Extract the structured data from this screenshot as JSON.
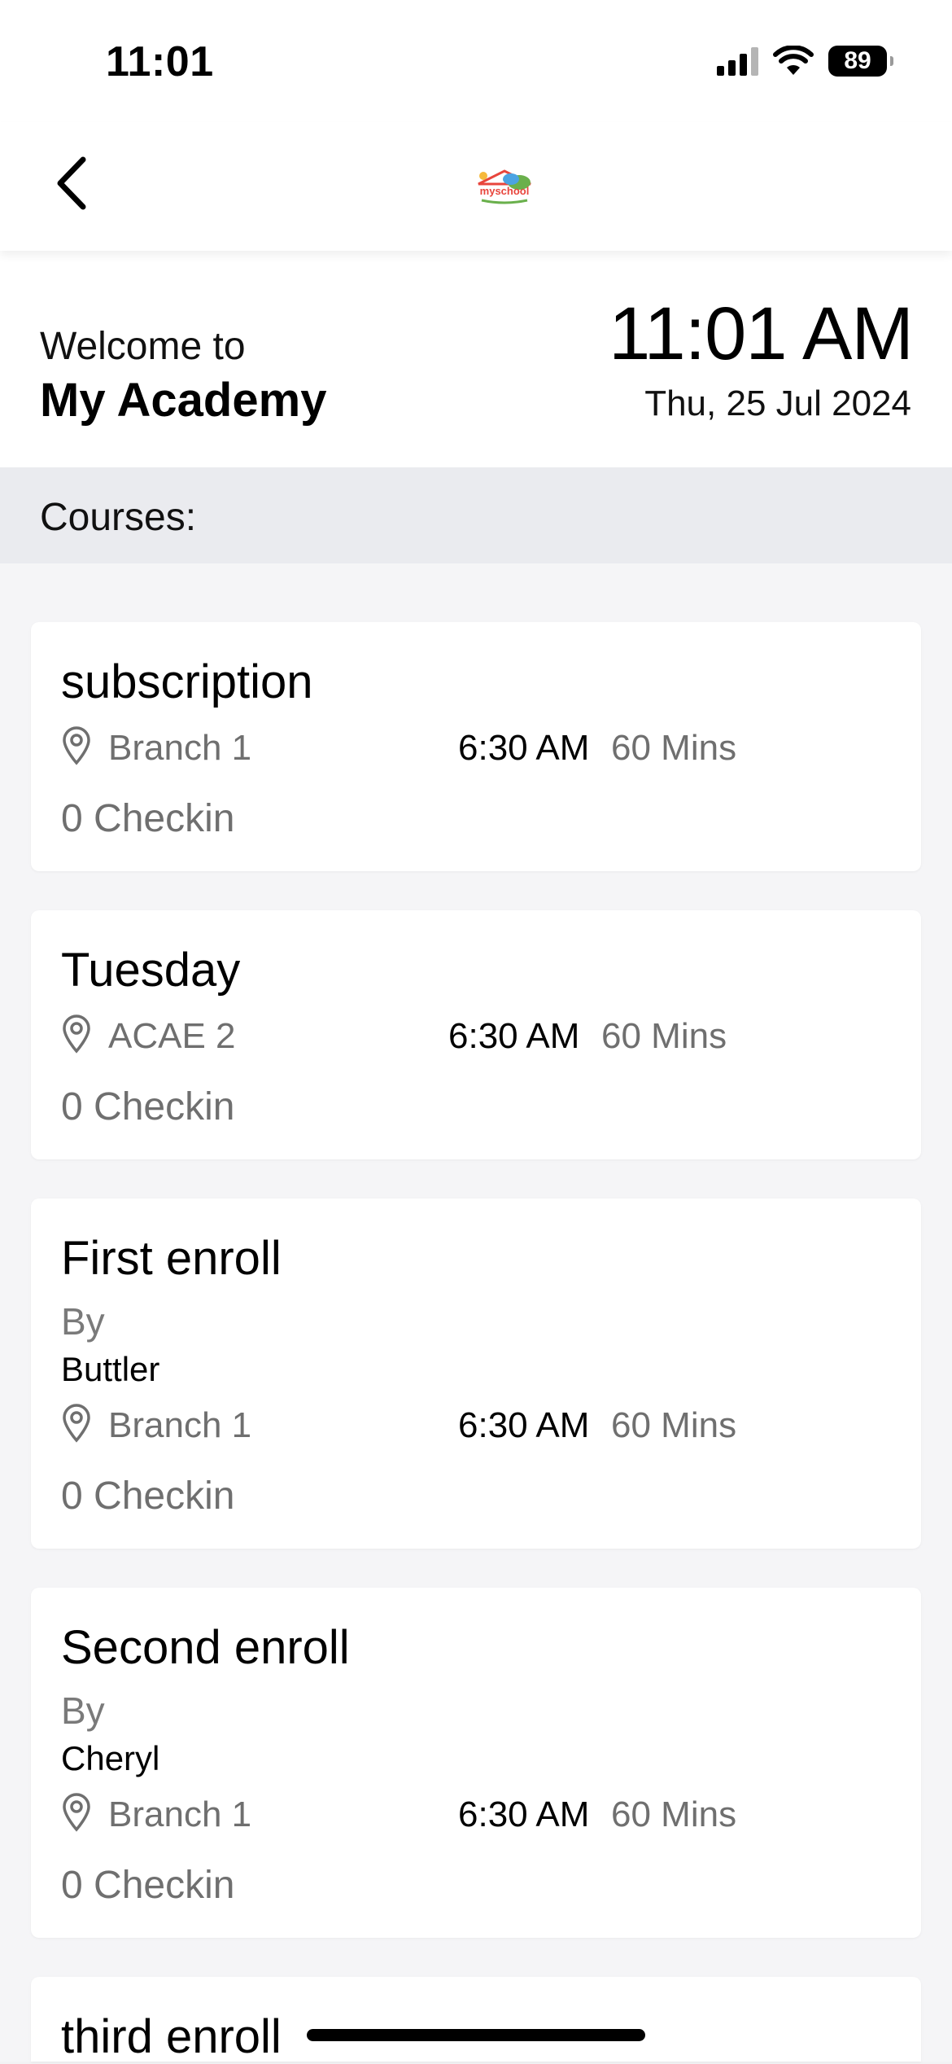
{
  "status_bar": {
    "time": "11:01",
    "battery": "89"
  },
  "nav": {
    "logo_text": "mySCHOOL"
  },
  "header": {
    "welcome": "Welcome to",
    "academy": "My Academy",
    "time": "11:01 AM",
    "date": "Thu, 25 Jul 2024"
  },
  "section": {
    "title": "Courses:"
  },
  "courses": [
    {
      "title": "subscription",
      "location": "Branch 1",
      "time": "6:30 AM",
      "duration": "60 Mins",
      "checkin": "0 Checkin"
    },
    {
      "title": "Tuesday",
      "location": "ACAE 2",
      "time": "6:30 AM",
      "duration": "60 Mins",
      "checkin": "0 Checkin"
    },
    {
      "title": "First enroll",
      "by_label": "By",
      "instructor": "Buttler",
      "location": "Branch 1",
      "time": "6:30 AM",
      "duration": "60 Mins",
      "checkin": "0 Checkin"
    },
    {
      "title": "Second enroll",
      "by_label": "By",
      "instructor": "Cheryl",
      "location": "Branch 1",
      "time": "6:30 AM",
      "duration": "60 Mins",
      "checkin": "0 Checkin"
    },
    {
      "title": "third enroll"
    }
  ]
}
